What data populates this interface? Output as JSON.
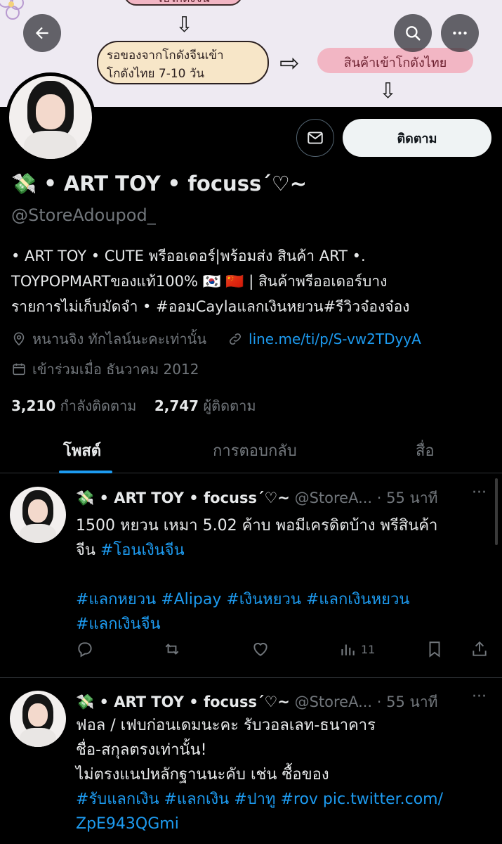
{
  "banner": {
    "top_label": "ไปโกดังจีน",
    "step_label_line1": "รอของจากโกดังจีนเข้า",
    "step_label_line2": "โกดังไทย 7-10 วัน",
    "right_label": "สินค้าเข้าโกดังไทย"
  },
  "icons": {
    "back": "back-arrow-icon",
    "search": "search-icon",
    "more": "more-horizontal-icon",
    "mail": "mail-icon",
    "location": "location-pin-icon",
    "link": "link-icon",
    "calendar": "calendar-icon"
  },
  "profile": {
    "display_name": "💸 • ART TOY • focuss´♡~",
    "handle": "@StoreAdoupod_",
    "follow_label": "ติดตาม",
    "bio_line1": "• ART TOY • CUTE พรีออเดอร์|พร้อมส่ง สินค้า ART •.",
    "bio_line2": "TOYPOPMARTของแท้100% 🇰🇷 🇨🇳 | สินค้าพรีออเดอร์บาง",
    "bio_line3": "รายการไม่เก็บมัดจำ • #ออมCaylaแลกเงินหยวน#รีวิวจ๋องจ๋อง",
    "location": "หนานจิง ทักไลน์นะคะเท่านั้น",
    "link": "line.me/ti/p/S-vw2TDyyA",
    "joined": "เข้าร่วมเมื่อ ธันวาคม 2012",
    "following_count": "3,210",
    "following_label": "กำลังติดตาม",
    "followers_count": "2,747",
    "followers_label": "ผู้ติดตาม"
  },
  "tabs": [
    {
      "label": "โพสต์",
      "active": true
    },
    {
      "label": "การตอบกลับ",
      "active": false
    },
    {
      "label": "สื่อ",
      "active": false
    }
  ],
  "tweets": [
    {
      "name": "💸 • ART TOY • focuss´♡~",
      "handle": "@StoreA...",
      "time": "· 55 นาที",
      "line1": "1500 หยวน เหมา 5.02 ค้าบ พอมีเครดิตบ้าง พรีสินค้า",
      "line2_text": "จีน ",
      "line2_hash": "#โอนเงินจีน",
      "hash_line1": "#แลกหยวน #Alipay #เงินหยวน #แลกเงินหยวน",
      "hash_line2": "#แลกเงินจีน",
      "views": "11"
    },
    {
      "name": "💸 • ART TOY • focuss´♡~",
      "handle": "@StoreA...",
      "time": "· 55 นาที",
      "line1": "ฟอล / เฟบก่อนเดมนะคะ รับวอลเลท-ธนาคาร",
      "line2": "ชื่อ-สกุลตรงเท่านั้น!",
      "line3": "ไม่ตรงแนปหลักฐานนะคับ เช่น ซื้อของ",
      "line4": "#รับแลกเงิน #แลกเงิน #ปาทู #rov pic.twitter.com/",
      "line5": "ZpE943QGmi"
    }
  ],
  "colors": {
    "accent": "#1d9bf0",
    "background": "#000000",
    "muted": "#71767b"
  }
}
